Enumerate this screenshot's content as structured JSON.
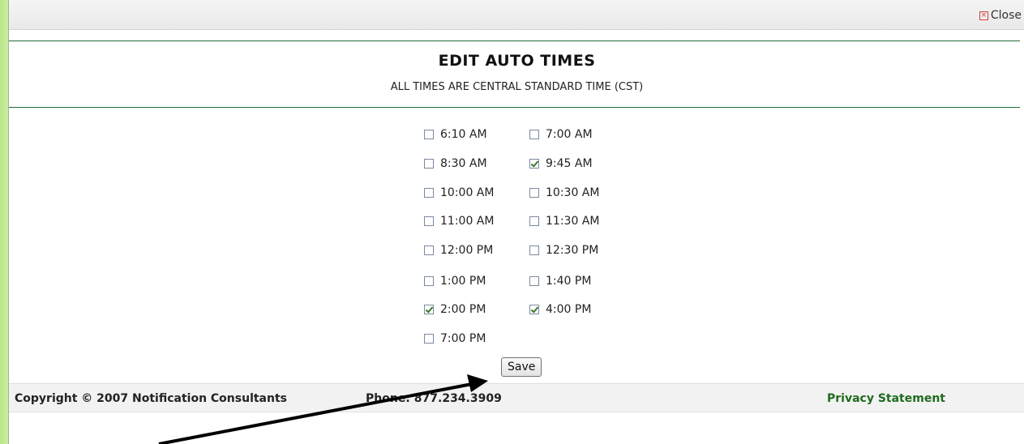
{
  "dialog": {
    "close_label": "Close",
    "title": "EDIT AUTO TIMES",
    "subtitle": "ALL TIMES ARE CENTRAL STANDARD TIME (CST)"
  },
  "times": [
    {
      "label": "6:10 AM",
      "checked": false
    },
    {
      "label": "7:00 AM",
      "checked": false
    },
    {
      "label": "8:30 AM",
      "checked": false
    },
    {
      "label": "9:45 AM",
      "checked": true
    },
    {
      "label": "10:00 AM",
      "checked": false
    },
    {
      "label": "10:30 AM",
      "checked": false
    },
    {
      "label": "11:00 AM",
      "checked": false
    },
    {
      "label": "11:30 AM",
      "checked": false
    },
    {
      "label": "12:00 PM",
      "checked": false
    },
    {
      "label": "12:30 PM",
      "checked": false
    },
    {
      "label": "1:00 PM",
      "checked": false
    },
    {
      "label": "1:40 PM",
      "checked": false
    },
    {
      "label": "2:00 PM",
      "checked": true
    },
    {
      "label": "4:00 PM",
      "checked": true
    },
    {
      "label": "7:00 PM",
      "checked": false
    }
  ],
  "save_label": "Save",
  "footer": {
    "copyright": "Copyright © 2007 Notification Consultants",
    "phone": "Phone: 877.234.3909",
    "privacy": "Privacy Statement"
  },
  "colors": {
    "accent_green": "#1f6b3a",
    "link_green": "#1f6b1f",
    "background_green": "#d3f0a6"
  }
}
